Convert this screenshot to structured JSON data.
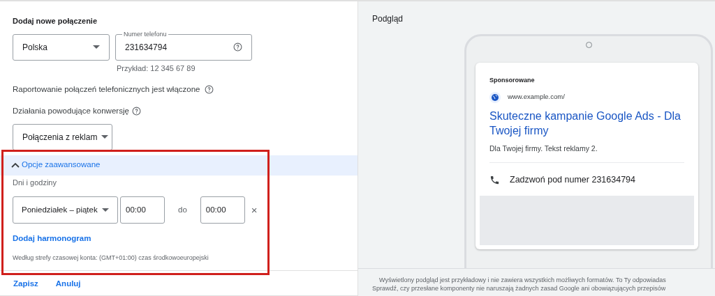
{
  "form": {
    "title": "Dodaj nowe połączenie",
    "country": {
      "value": "Polska"
    },
    "phone": {
      "label": "Numer telefonu",
      "value": "231634794",
      "hint": "Przykład: 12 345 67 89"
    },
    "reporting": "Raportowanie połączeń telefonicznych jest włączone",
    "conversion_label": "Działania powodujące konwersję",
    "conversion": {
      "value": "Połączenia z reklam"
    },
    "advanced": {
      "label": "Opcje zaawansowane",
      "expanded": true,
      "highlighted": true,
      "schedule_label": "Dni i godziny",
      "days": {
        "value": "Poniedziałek – piątek"
      },
      "from": "00:00",
      "to_label": "do",
      "to": "00:00",
      "remove": "×",
      "add_schedule": "Dodaj harmonogram",
      "timezone": "Według strefy czasowej konta: (GMT+01:00) czas środkowoeuropejski"
    },
    "actions": [
      "Zapisz",
      "Anuluj"
    ]
  },
  "preview": {
    "title": "Podgląd",
    "ad": {
      "sponsored": "Sponsorowane",
      "url": "www.example.com/",
      "headline": "Skuteczne kampanie Google Ads - Dla Twojej firmy",
      "description": "Dla Twojej firmy. Tekst reklamy 2.",
      "call": "Zadzwoń pod numer 231634794"
    },
    "disclaimer": [
      "Wyświetlony podgląd jest przykładowy i nie zawiera wszystkich możliwych formatów. To Ty odpowiadas",
      "Sprawdź, czy przesłane komponenty nie naruszają żadnych zasad Google ani obowiązujących przepisów"
    ]
  }
}
